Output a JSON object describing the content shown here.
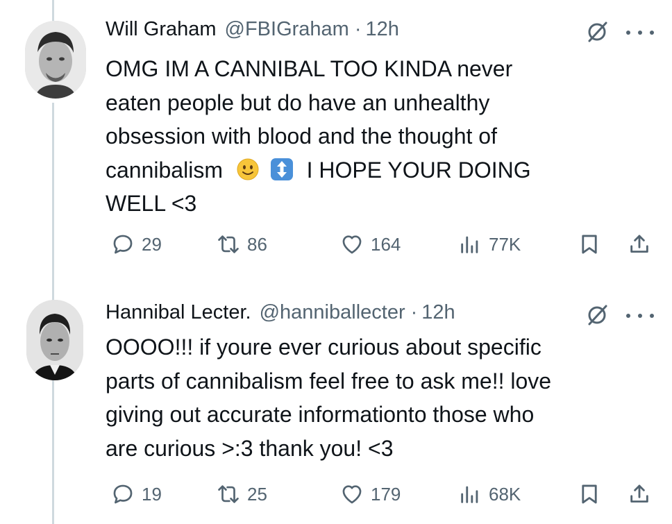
{
  "tweets": [
    {
      "author": {
        "name": "Will Graham",
        "handle": "@FBIGraham",
        "time": "12h"
      },
      "text": {
        "line1": "OMG IM A CANNIBAL TOO KINDA never",
        "line2": "eaten people but do have an unhealthy",
        "line3": "obsession with blood and the thought of",
        "line4_before": "cannibalism",
        "line4_after": "I HOPE YOUR DOING",
        "line5": "WELL <3",
        "emojis": [
          "slightly-smiling-face",
          "up-down-arrow"
        ]
      },
      "stats": {
        "replies": "29",
        "reposts": "86",
        "likes": "164",
        "views": "77K"
      }
    },
    {
      "author": {
        "name": "Hannibal Lecter.",
        "handle": "@hanniballecter",
        "time": "12h"
      },
      "text": {
        "line1": "OOOO!!! if youre ever curious about specific",
        "line2": "parts of cannibalism feel free to ask me!! love",
        "line3": "giving out accurate informationto those who",
        "line4": "are curious >:3 thank you! <3"
      },
      "stats": {
        "replies": "19",
        "reposts": "25",
        "likes": "179",
        "views": "68K"
      }
    }
  ],
  "separator": "·",
  "colors": {
    "text": "#0f1419",
    "secondary": "#536471",
    "thread_line": "#cfd9de"
  }
}
